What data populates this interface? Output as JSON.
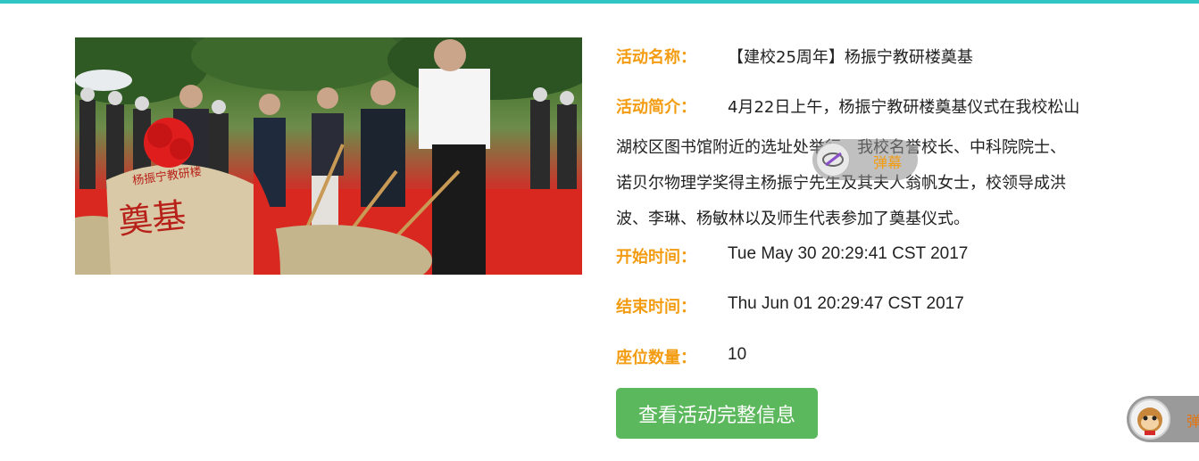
{
  "activity": {
    "name_label": "活动名称：",
    "name_value": "【建校25周年】杨振宁教研楼奠基",
    "intro_label": "活动简介：",
    "intro_line1": "4月22日上午，杨振宁教研楼奠基仪式在我校松山",
    "intro_line2": "湖校区图书馆附近的选址处举行，我校名誉校长、中科院院士、",
    "intro_line3": "诺贝尔物理学奖得主杨振宁先生及其夫人翁帆女士，校领导成洪",
    "intro_line4": "波、李琳、杨敏林以及师生代表参加了奠基仪式。",
    "start_label": "开始时间：",
    "start_value": "Tue May 30 20:29:41 CST 2017",
    "end_label": "结束时间：",
    "end_value": "Thu Jun 01 20:29:47 CST 2017",
    "seats_label": "座位数量：",
    "seats_value": "10",
    "details_button": "查看活动完整信息"
  },
  "photo": {
    "stone_small_text": "杨振宁教研楼",
    "stone_big_text": "奠基"
  },
  "danmu": {
    "float_label": "弹幕",
    "corner_label": "弹"
  },
  "colors": {
    "topbar": "#2ec5c3",
    "label": "#f39c12",
    "button": "#5cb85c"
  }
}
